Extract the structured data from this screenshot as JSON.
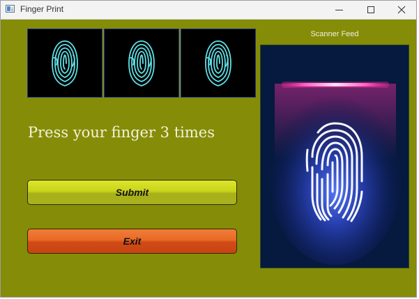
{
  "window": {
    "title": "Finger Print",
    "icon": "window-app-icon",
    "controls": [
      "minimize-icon",
      "maximize-icon",
      "close-icon"
    ]
  },
  "prompt": "Press your finger 3 times",
  "buttons": {
    "submit": "Submit",
    "exit": "Exit"
  },
  "scanner": {
    "label": "Scanner Feed"
  },
  "thumbnails": [
    {
      "icon": "fingerprint-icon"
    },
    {
      "icon": "fingerprint-icon"
    },
    {
      "icon": "fingerprint-icon"
    }
  ],
  "colors": {
    "background": "#858c08",
    "submit": "#c9d41c",
    "exit": "#e06020",
    "thumb_print": "#5fe0e6",
    "scanner_glow": "#3a8cff",
    "scan_line": "#ff2da0"
  }
}
